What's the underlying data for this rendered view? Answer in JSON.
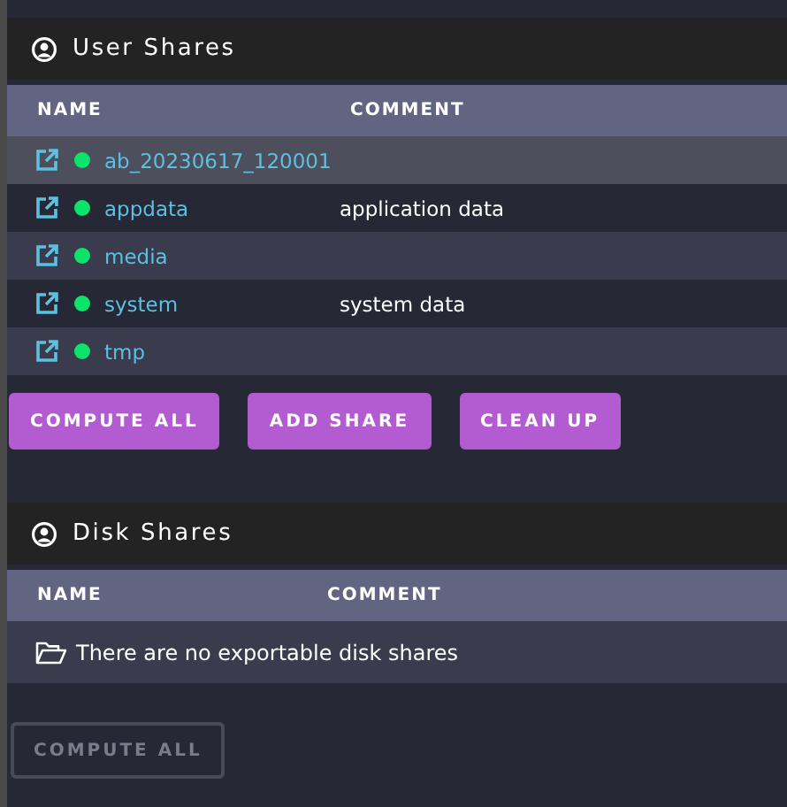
{
  "user_shares": {
    "title": "User Shares",
    "columns": [
      "NAME",
      "COMMENT"
    ],
    "rows": [
      {
        "name": "ab_20230617_120001",
        "comment": "",
        "highlighted": true
      },
      {
        "name": "appdata",
        "comment": "application data",
        "highlighted": false
      },
      {
        "name": "media",
        "comment": "",
        "highlighted": false
      },
      {
        "name": "system",
        "comment": "system data",
        "highlighted": false
      },
      {
        "name": "tmp",
        "comment": "",
        "highlighted": false
      }
    ],
    "buttons": [
      {
        "label": "COMPUTE ALL",
        "disabled": false
      },
      {
        "label": "ADD SHARE",
        "disabled": false
      },
      {
        "label": "CLEAN UP",
        "disabled": false
      }
    ]
  },
  "disk_shares": {
    "title": "Disk Shares",
    "columns": [
      "NAME",
      "COMMENT"
    ],
    "empty_message": "There are no exportable disk shares",
    "buttons": [
      {
        "label": "COMPUTE ALL",
        "disabled": true
      }
    ]
  }
}
